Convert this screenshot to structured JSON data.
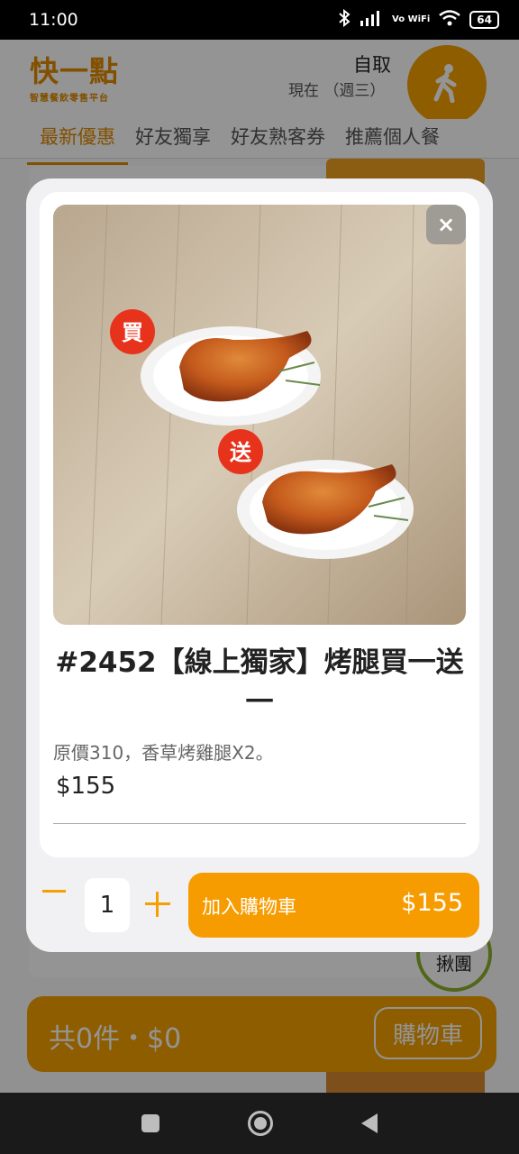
{
  "status_bar": {
    "time": "11:00",
    "signal_label": "Vo WiFi",
    "battery": "64",
    "icons": [
      "bluetooth-icon",
      "signal-icon",
      "wifi-icon",
      "battery-icon"
    ]
  },
  "app": {
    "logo_text": "快一點",
    "logo_subtitle": "智慧餐飲零售平台",
    "pickup_mode": "自取",
    "pickup_time": "現在 （週三）",
    "tabs": [
      {
        "label": "最新優惠",
        "active": true
      },
      {
        "label": "好友獨享",
        "active": false
      },
      {
        "label": "好友熟客券",
        "active": false
      },
      {
        "label": "推薦個人餐",
        "active": false
      }
    ],
    "group_button_label": "揪團",
    "cart_summary": "共0件・$0",
    "cart_button_label": "購物車"
  },
  "modal": {
    "image_badges": [
      "買",
      "送"
    ],
    "close_label": "×",
    "title": "#2452【線上獨家】烤腿買一送一",
    "description": "原價310，香草烤雞腿X2。",
    "price": "$155",
    "quantity": "1",
    "add_to_cart_label": "加入購物車",
    "add_to_cart_price": "$155"
  },
  "colors": {
    "accent": "#F79C00",
    "brand": "#E08A00",
    "badge_red": "#E8331C"
  }
}
